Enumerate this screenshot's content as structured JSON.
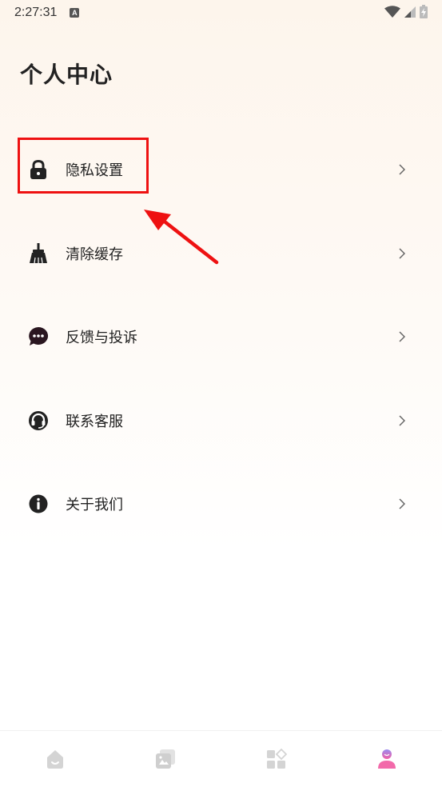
{
  "status_bar": {
    "time": "2:27:31",
    "notification_letter": "A"
  },
  "page": {
    "title": "个人中心"
  },
  "menu": [
    {
      "label": "隐私设置",
      "icon": "lock-icon"
    },
    {
      "label": "清除缓存",
      "icon": "broom-icon"
    },
    {
      "label": "反馈与投诉",
      "icon": "chat-bubble-icon"
    },
    {
      "label": "联系客服",
      "icon": "headset-icon"
    },
    {
      "label": "关于我们",
      "icon": "info-icon"
    }
  ],
  "annotation": {
    "highlighted_item": "隐私设置",
    "color": "#ee1111"
  },
  "tab_bar": {
    "tabs": [
      {
        "icon": "home-icon",
        "active": false
      },
      {
        "icon": "gallery-icon",
        "active": false
      },
      {
        "icon": "apps-icon",
        "active": false
      },
      {
        "icon": "profile-icon",
        "active": true
      }
    ]
  },
  "colors": {
    "accent": "#e4509a",
    "inactive_icon": "#d4d4d4"
  }
}
